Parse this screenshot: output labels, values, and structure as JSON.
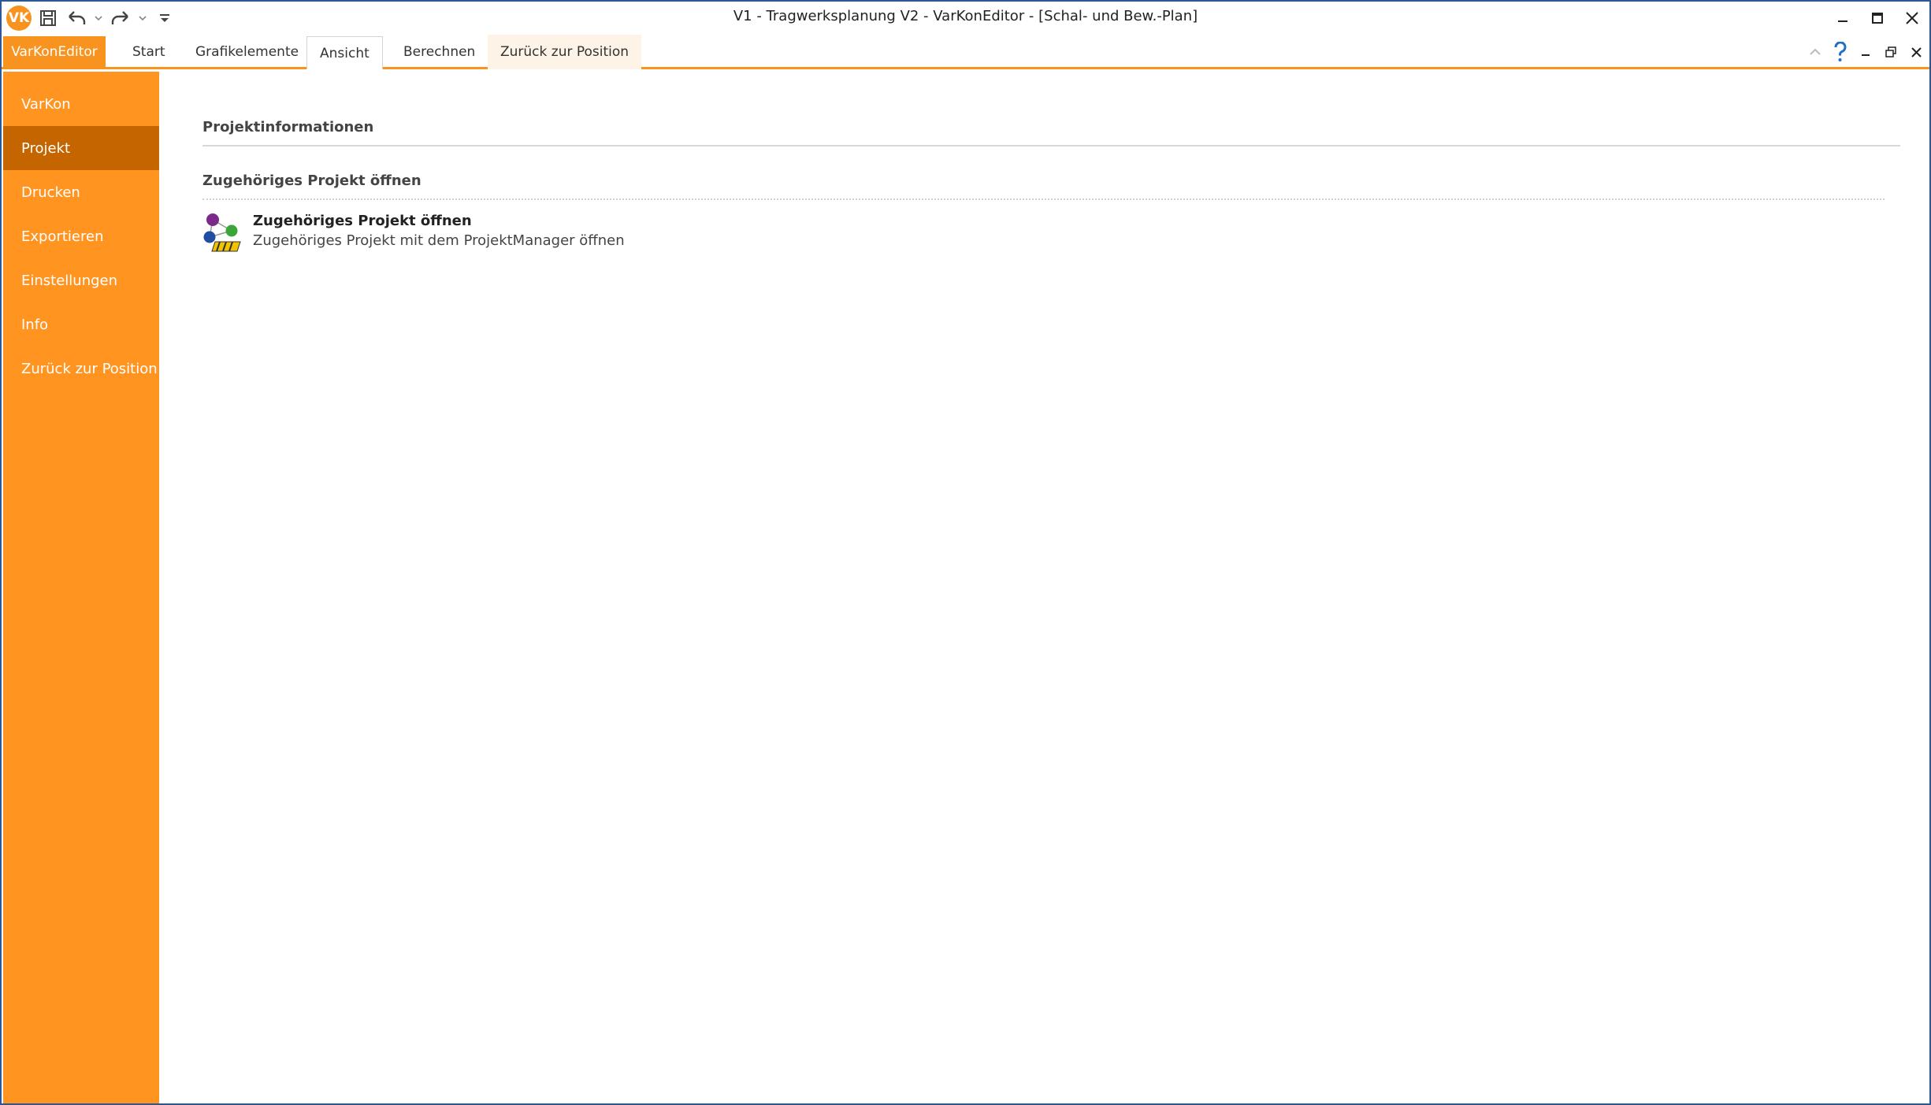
{
  "window": {
    "title": "V1 - Tragwerksplanung V2 - VarKonEditor - [Schal- und Bew.-Plan]",
    "app_logo_text": "VK",
    "border_color": "#2b5797"
  },
  "ribbon": {
    "app_tab": "VarKonEditor",
    "tabs": [
      "Start",
      "Grafikelemente",
      "Ansicht",
      "Berechnen",
      "Zurück zur Position"
    ],
    "selected_tab": "Ansicht",
    "accent": "#f7931e"
  },
  "sidebar": {
    "items": [
      {
        "label": "VarKon"
      },
      {
        "label": "Projekt"
      },
      {
        "label": "Drucken"
      },
      {
        "label": "Exportieren"
      },
      {
        "label": "Einstellungen"
      },
      {
        "label": "Info"
      },
      {
        "label": "Zurück zur Position"
      }
    ],
    "active": "Projekt",
    "bg_color": "#ff9421",
    "active_color": "#c46500"
  },
  "content": {
    "section1_title": "Projektinformationen",
    "section2_title": "Zugehöriges Projekt öffnen",
    "command": {
      "title": "Zugehöriges Projekt öffnen",
      "description": "Zugehöriges Projekt mit dem ProjektManager öffnen",
      "icon": "project-manager-icon"
    }
  },
  "icons": {
    "save": "save-icon",
    "undo": "undo-icon",
    "redo": "redo-icon",
    "customize": "customize-qat-icon",
    "minimize": "minimize-icon",
    "maximize": "maximize-icon",
    "close": "close-icon",
    "collapse": "collapse-ribbon-icon",
    "help": "help-icon"
  }
}
